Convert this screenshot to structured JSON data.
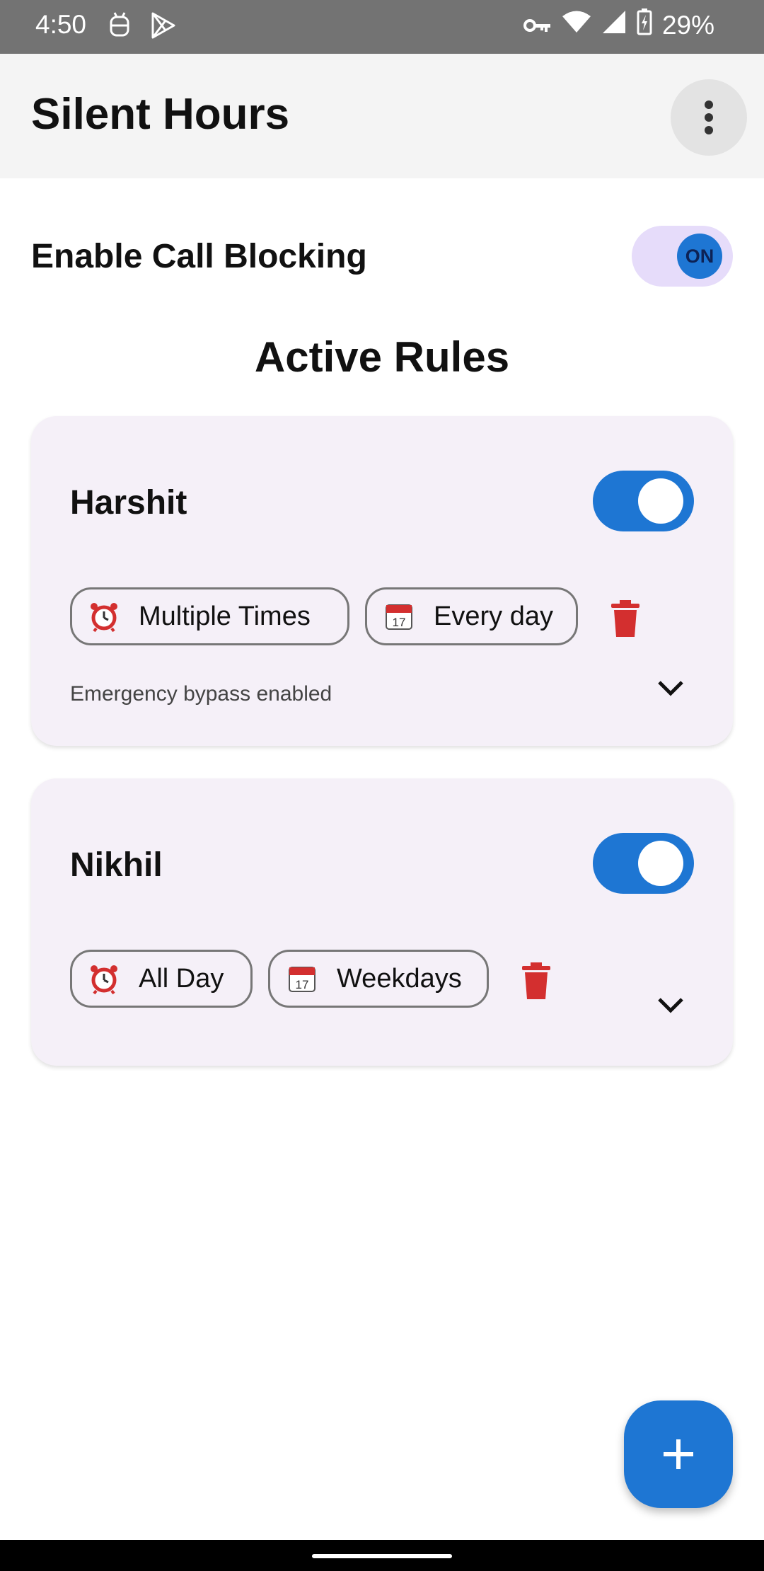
{
  "status_bar": {
    "time": "4:50",
    "battery": "29%",
    "icons": [
      "android-icon",
      "play-store-icon",
      "vpn-key-icon",
      "wifi-icon",
      "signal-icon",
      "battery-charging-icon"
    ]
  },
  "app_bar": {
    "title": "Silent Hours",
    "menu_icon": "more-vertical-icon"
  },
  "call_blocking": {
    "label": "Enable Call Blocking",
    "switch_text": "ON",
    "enabled": true
  },
  "rules_section": {
    "title": "Active Rules"
  },
  "rules": [
    {
      "name": "Harshit",
      "enabled": true,
      "time_chip": "Multiple Times",
      "days_chip": "Every day",
      "note": "Emergency bypass enabled"
    },
    {
      "name": "Nikhil",
      "enabled": true,
      "time_chip": "All Day",
      "days_chip": "Weekdays",
      "note": ""
    }
  ],
  "fab": {
    "icon": "add-icon"
  },
  "colors": {
    "accent": "#1e76d3",
    "card_bg": "#f5f0f8",
    "delete": "#d32f2f",
    "switch_track_light": "#e6dcfa"
  }
}
